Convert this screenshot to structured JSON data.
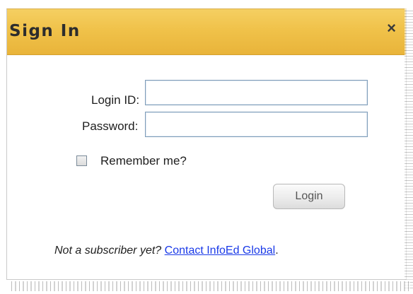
{
  "dialog": {
    "title": "Sign In",
    "close_label": "×"
  },
  "form": {
    "login_id_label": "Login ID:",
    "login_id_value": "",
    "password_label": "Password:",
    "password_value": "",
    "remember_label": "Remember me?",
    "remember_checked": false,
    "login_button": "Login"
  },
  "footer": {
    "prompt": "Not a subscriber yet?",
    "link_text": "Contact InfoEd Global",
    "trailing": "."
  },
  "colors": {
    "header": "#f0c24a",
    "link": "#1a3ae8",
    "field_border": "#7f9db9"
  }
}
